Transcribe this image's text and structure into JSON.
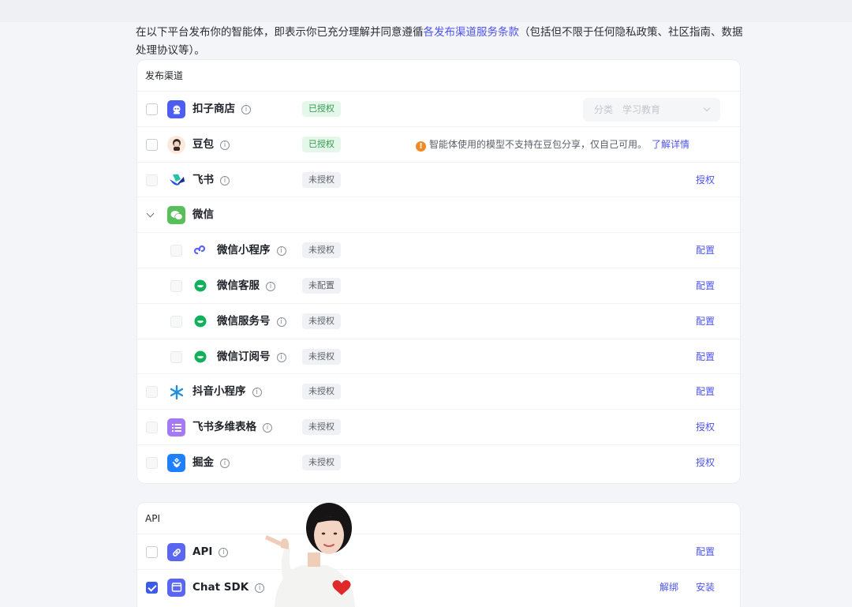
{
  "intro": {
    "prefix": "在以下平台发布你的智能体，即表示你已充分理解并同意遵循",
    "link": "各发布渠道服务条款",
    "suffix": "（包括但不限于任何隐私政策、社区指南、数据处理协议等）。"
  },
  "channels": {
    "header": "发布渠道",
    "kouzi": {
      "name": "扣子商店",
      "status": "已授权",
      "select_label": "分类",
      "select_value": "学习教育"
    },
    "doubao": {
      "name": "豆包",
      "status": "已授权",
      "warning": "智能体使用的模型不支持在豆包分享，仅自己可用。",
      "warning_link": "了解详情",
      "warning_mark": "!"
    },
    "feishu": {
      "name": "飞书",
      "status": "未授权",
      "action": "授权"
    },
    "wechat": {
      "name": "微信"
    },
    "wechat_mini": {
      "name": "微信小程序",
      "status": "未授权",
      "action": "配置"
    },
    "wechat_kf": {
      "name": "微信客服",
      "status": "未配置",
      "action": "配置"
    },
    "wechat_service": {
      "name": "微信服务号",
      "status": "未授权",
      "action": "配置"
    },
    "wechat_sub": {
      "name": "微信订阅号",
      "status": "未授权",
      "action": "配置"
    },
    "douyin_mini": {
      "name": "抖音小程序",
      "status": "未授权",
      "action": "配置"
    },
    "feishu_table": {
      "name": "飞书多维表格",
      "status": "未授权",
      "action": "授权"
    },
    "juejin": {
      "name": "掘金",
      "status": "未授权",
      "action": "授权"
    }
  },
  "api": {
    "header": "API",
    "api": {
      "name": "API",
      "action": "配置"
    },
    "chat_sdk": {
      "name": "Chat SDK",
      "action_unbind": "解绑",
      "action_install": "安装",
      "checked": true
    }
  },
  "info_glyph": "i",
  "colors": {
    "accent": "#4d53e8",
    "ok_bg": "#e5f7ea",
    "ok_text": "#2f9a4f",
    "warn": "#f08a24"
  }
}
